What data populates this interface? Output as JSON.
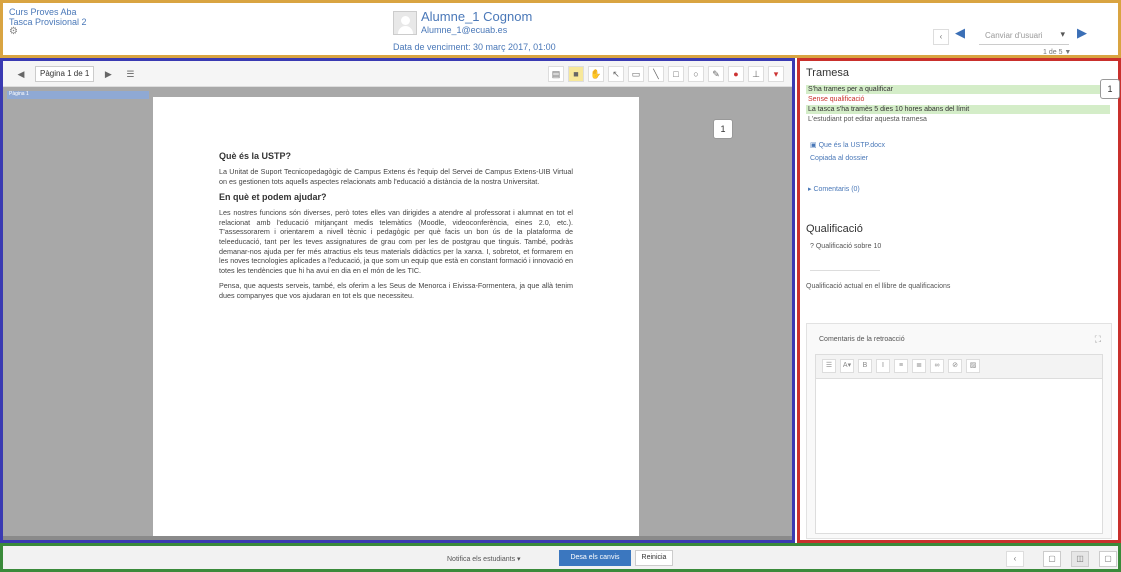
{
  "header": {
    "course_line1": "Curs Proves Aba",
    "course_line2": "Tasca Provisional 2",
    "student_name": "Alumne_1 Cognom",
    "student_email": "Alumne_1@ecuab.es",
    "due_date": "Data de venciment: 30 març 2017, 01:00",
    "user_select": "Canviar d'usuari",
    "user_count": "1 de 5"
  },
  "doc_toolbar": {
    "page_select": "Pàgina 1 de 1"
  },
  "document": {
    "thumb_label": "Pàgina 1",
    "heading1": "Què és la USTP?",
    "para1": "La Unitat de Suport Tecnicopedagògic de Campus Extens és l'equip del Servei de Campus Extens-UIB Virtual on es gestionen tots aquells aspectes relacionats amb l'educació a distància de la nostra Universitat.",
    "heading2": "En què et podem ajudar?",
    "para2": "Les nostres funcions són diverses, però totes elles van dirigides a atendre al professorat i alumnat en tot el relacionat amb l'educació mitjançant medis telemàtics (Moodle, videoconferència, eines 2.0, etc.). T'assessorarem i orientarem a nivell tècnic i pedagògic per què facis un bon ús de la plataforma de teleeducació, tant per les teves assignatures de grau com per les de postgrau que tinguis. També, podràs demanar-nos ajuda per fer més atractius els teus materials didàctics per la xarxa. I, sobretot, et formarem en les noves tecnologies aplicades a l'educació, ja que som un equip que està en constant formació i innovació en totes les tendències que hi ha avui en dia en el món de les TIC.",
    "para3": "Pensa, que aquests serveis, també, els oferim a les Seus de Menorca i Eivissa-Formentera, ja que allà tenim dues companyes que vos ajudaran en tot els que necessiteu.",
    "marker": "1"
  },
  "submission": {
    "title": "Tramesa",
    "status1": "S'ha trames per a qualificar",
    "status2": "Sense qualificació",
    "status3": "La tasca s'ha tramès 5 dies 10 hores abans del límit",
    "status4": "L'estudiant pot editar aquesta tramesa",
    "file_link": "Que és la USTP.docx",
    "copy_link": "Copiada al dossier",
    "comments_link": "Comentaris (0)",
    "marker": "1"
  },
  "grading": {
    "title": "Qualificació",
    "grade_label": "Qualificació sobre 10",
    "gradebook_text": "Qualificació actual en el llibre de qualificacions",
    "feedback_label": "Comentaris de la retroacció"
  },
  "footer": {
    "notify_label": "Notifica els estudiants",
    "save_label": "Desa els canvis",
    "reset_label": "Reinicia"
  }
}
